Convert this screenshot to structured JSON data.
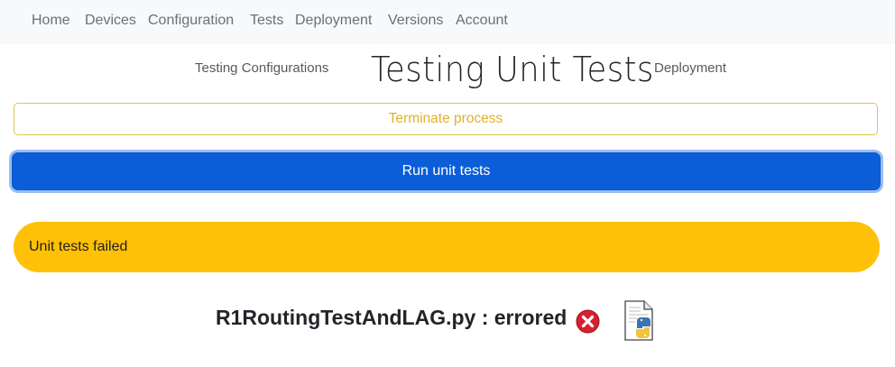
{
  "nav": {
    "items": [
      {
        "label": "Home"
      },
      {
        "label": "Devices"
      },
      {
        "label": "Configuration"
      },
      {
        "label": "Tests"
      },
      {
        "label": "Deployment"
      },
      {
        "label": "Versions"
      },
      {
        "label": "Account"
      }
    ]
  },
  "subnav": {
    "prev_label": "Testing Configurations",
    "title": "Testing Unit Tests",
    "next_label": "Deployment"
  },
  "actions": {
    "terminate_label": "Terminate process",
    "run_label": "Run unit tests"
  },
  "alert": {
    "text": "Unit tests failed",
    "color": "#ffc107"
  },
  "results": [
    {
      "label": "R1RoutingTestAndLAG.py : errored",
      "status_icon": "error-x-icon",
      "file_icon": "python-file-icon"
    }
  ],
  "colors": {
    "primary": "#0b5ed7",
    "warning": "#ffc107",
    "error": "#d6202e"
  }
}
